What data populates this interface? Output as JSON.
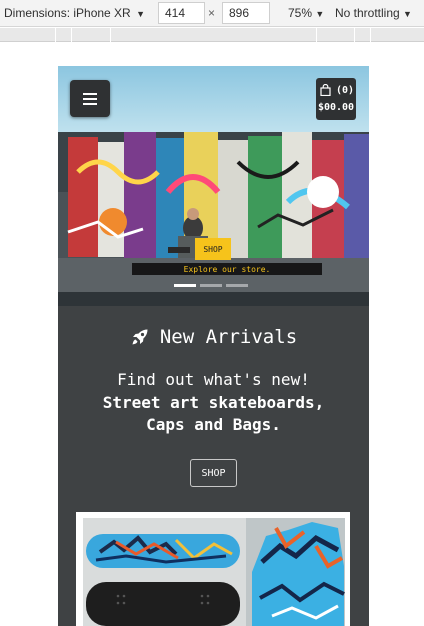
{
  "devtools": {
    "device_label": "Dimensions: iPhone XR",
    "caret": "▼",
    "width_value": "414",
    "height_value": "896",
    "times": "×",
    "zoom_label": "75%",
    "throttle_label": "No throttling"
  },
  "header": {
    "menu_icon": "hamburger-menu-icon",
    "cart_icon": "shopping-bag-icon",
    "cart_count": "(0)",
    "cart_total": "$00.00"
  },
  "hero": {
    "image": "graffiti-skateboarder-photo",
    "shop_label": "SHOP",
    "caption": "Explore our store.",
    "slides": 3,
    "active_slide": 1
  },
  "new_arrivals": {
    "icon": "rocket-icon",
    "title": "New Arrivals",
    "subtitle_line1": "Find out what's new!",
    "subtitle_line2": "Street art skateboards,",
    "subtitle_line3": "Caps and Bags.",
    "shop_label": "SHOP"
  },
  "product_card": {
    "image": "graffiti-skateboard-decks-photo"
  },
  "colors": {
    "page_bg": "#3f4244",
    "accent_yellow": "#f6c31b",
    "header_sky": "#8cc6e0",
    "button_dark": "#2f3133"
  }
}
